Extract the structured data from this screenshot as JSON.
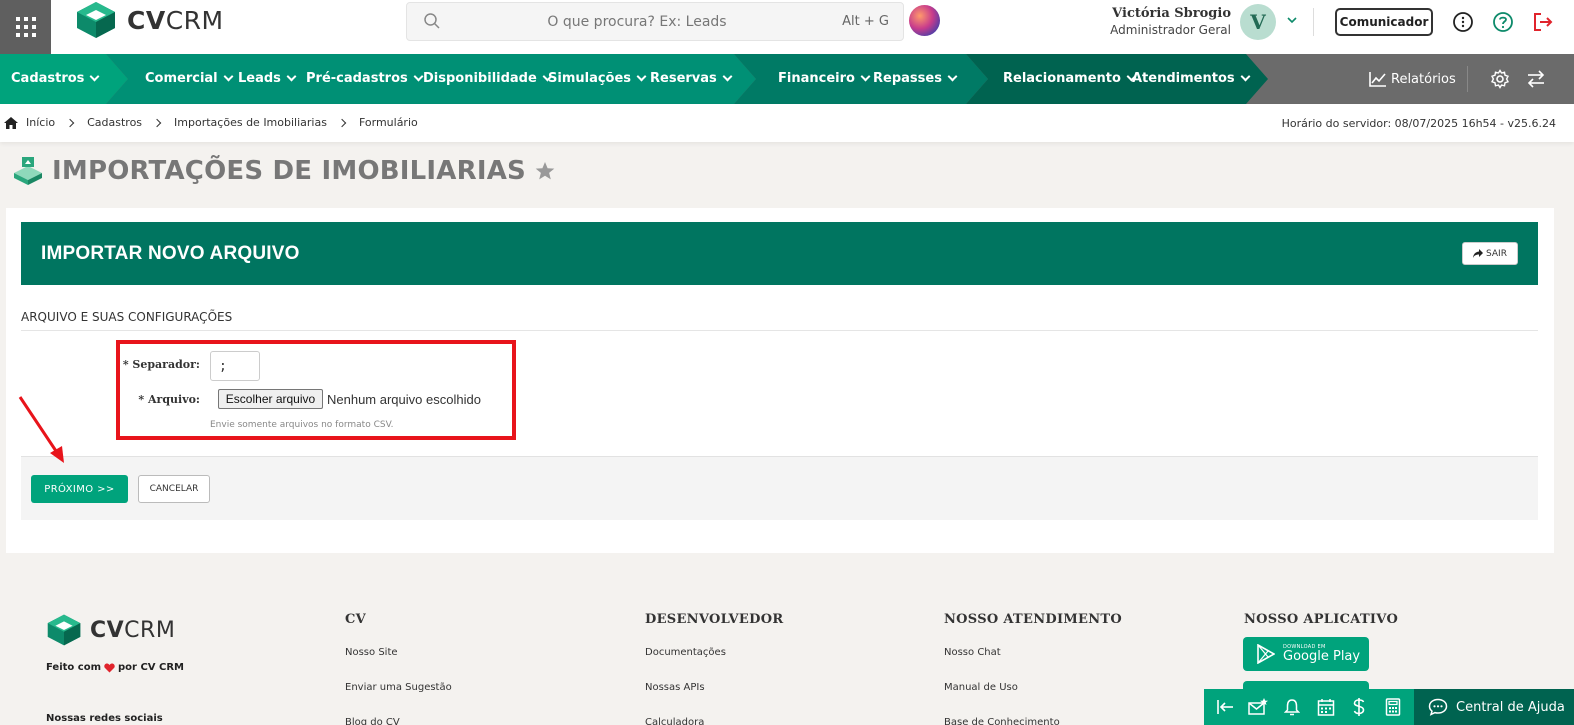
{
  "topbar": {
    "logo_bold": "CV",
    "logo_light": "CRM",
    "search_placeholder": "O que procura? Ex: Leads",
    "search_shortcut": "Alt + G",
    "user_name": "Victória Sbrogio",
    "user_role": "Administrador Geral",
    "avatar_letter": "V",
    "comunicador_label": "Comunicador"
  },
  "nav": {
    "cadastros": "Cadastros",
    "group1": [
      "Comercial",
      "Leads",
      "Pré-cadastros",
      "Disponibilidade",
      "Simulações",
      "Reservas"
    ],
    "group2": [
      "Financeiro",
      "Repasses"
    ],
    "group3": [
      "Relacionamento",
      "Atendimentos"
    ],
    "relatorios": "Relatórios"
  },
  "breadcrumb": {
    "items": [
      "Início",
      "Cadastros",
      "Importações de Imobiliarias",
      "Formulário"
    ],
    "server_time": "Horário do servidor: 08/07/2025 16h54 - v25.6.24"
  },
  "page": {
    "title": "IMPORTAÇÕES DE IMOBILIARIAS"
  },
  "panel": {
    "header_title": "IMPORTAR NOVO ARQUIVO",
    "sair_label": "SAIR",
    "section_label": "ARQUIVO E SUAS CONFIGURAÇÕES",
    "separador_label": "* Separador:",
    "separador_value": ";",
    "arquivo_label": "* Arquivo:",
    "file_button": "Escolher arquivo",
    "file_status": "Nenhum arquivo escolhido",
    "hint": "Envie somente arquivos no formato CSV.",
    "next_label": "PRÓXIMO >>",
    "cancel_label": "CANCELAR"
  },
  "footer": {
    "logo_bold": "CV",
    "logo_light": "CRM",
    "made_prefix": "Feito com",
    "made_suffix": "por CV CRM",
    "social": "Nossas redes sociais",
    "cols": [
      {
        "title": "CV",
        "links": [
          "Nosso Site",
          "Enviar uma Sugestão",
          "Blog do CV"
        ]
      },
      {
        "title": "DESENVOLVEDOR",
        "links": [
          "Documentações",
          "Nossas APIs",
          "Calculadora"
        ]
      },
      {
        "title": "NOSSO ATENDIMENTO",
        "links": [
          "Nosso Chat",
          "Manual de Uso",
          "Base de Conhecimento"
        ]
      },
      {
        "title": "NOSSO APLICATIVO",
        "links": []
      }
    ],
    "store_small": "DOWNLOAD EM",
    "store_big": "Google Play"
  },
  "dock": {
    "help_label": "Central de Ajuda"
  },
  "colors": {
    "brand_green": "#00a37c",
    "dark_green": "#007560",
    "highlight_red": "#e8141b"
  }
}
